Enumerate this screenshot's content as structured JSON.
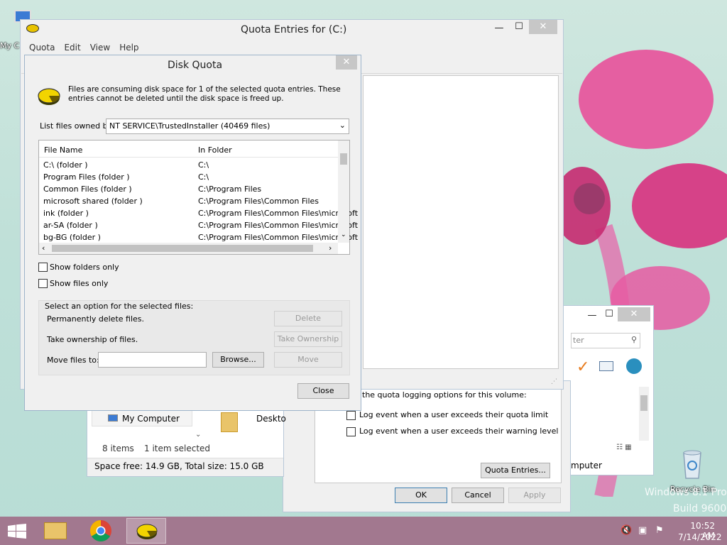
{
  "desktop": {
    "icon_my_computer_label": "My C",
    "recycle_bin_label": "Recycle Bin",
    "watermark_line1": "Windows 8.1 Pro",
    "watermark_line2": "Build 9600"
  },
  "quota_window": {
    "title": "Quota Entries for  (C:)",
    "menu": [
      "Quota",
      "Edit",
      "View",
      "Help"
    ],
    "controls": {
      "minimize": "—",
      "maximize": "☐",
      "close": "✕"
    }
  },
  "disk_quota_dialog": {
    "title": "Disk Quota",
    "close": "✕",
    "message": "Files are consuming disk space for 1 of the selected quota entries.  These entries cannot be deleted until the disk space is freed up.",
    "owner_label": "List files owned by:",
    "owner_value": "NT SERVICE\\TrustedInstaller (40469 files)",
    "columns": [
      "File Name",
      "In Folder"
    ],
    "rows": [
      {
        "name": "C:\\  (folder )",
        "folder": "C:\\"
      },
      {
        "name": "Program Files  (folder )",
        "folder": "C:\\"
      },
      {
        "name": "Common Files  (folder )",
        "folder": "C:\\Program Files"
      },
      {
        "name": "microsoft shared  (folder )",
        "folder": "C:\\Program Files\\Common Files"
      },
      {
        "name": "ink  (folder )",
        "folder": "C:\\Program Files\\Common Files\\microsoft"
      },
      {
        "name": "ar-SA  (folder )",
        "folder": "C:\\Program Files\\Common Files\\microsoft"
      },
      {
        "name": "bg-BG  (folder )",
        "folder": "C:\\Program Files\\Common Files\\microsoft"
      }
    ],
    "show_folders_only": "Show folders only",
    "show_files_only": "Show files only",
    "group_label": "Select an option for the selected files:",
    "delete_label": "Permanently delete files.",
    "delete_btn": "Delete",
    "ownership_label": "Take ownership of files.",
    "ownership_btn": "Take Ownership",
    "move_label": "Move files to:",
    "move_value": "",
    "browse_btn": "Browse...",
    "move_btn": "Move",
    "close_btn": "Close"
  },
  "explorer_bg": {
    "nav_item": "My Computer",
    "content_item": "Deskto",
    "status_items": "8 items",
    "status_selected": "1 item selected",
    "space": "Space free: 14.9 GB, Total size: 15.0 GB"
  },
  "properties_bg": {
    "logging_text": "the quota logging options for this volume:",
    "log_limit": "Log event when a user exceeds their quota limit",
    "log_warning": "Log event when a user exceeds their warning level",
    "quota_entries_btn": "Quota Entries...",
    "ok": "OK",
    "cancel": "Cancel",
    "apply": "Apply"
  },
  "explorer_right": {
    "search_partial": "ter",
    "status_partial": "mputer"
  },
  "taskbar": {
    "time": "10:52 AM",
    "date": "7/14/2022",
    "color": "#a2788f"
  }
}
